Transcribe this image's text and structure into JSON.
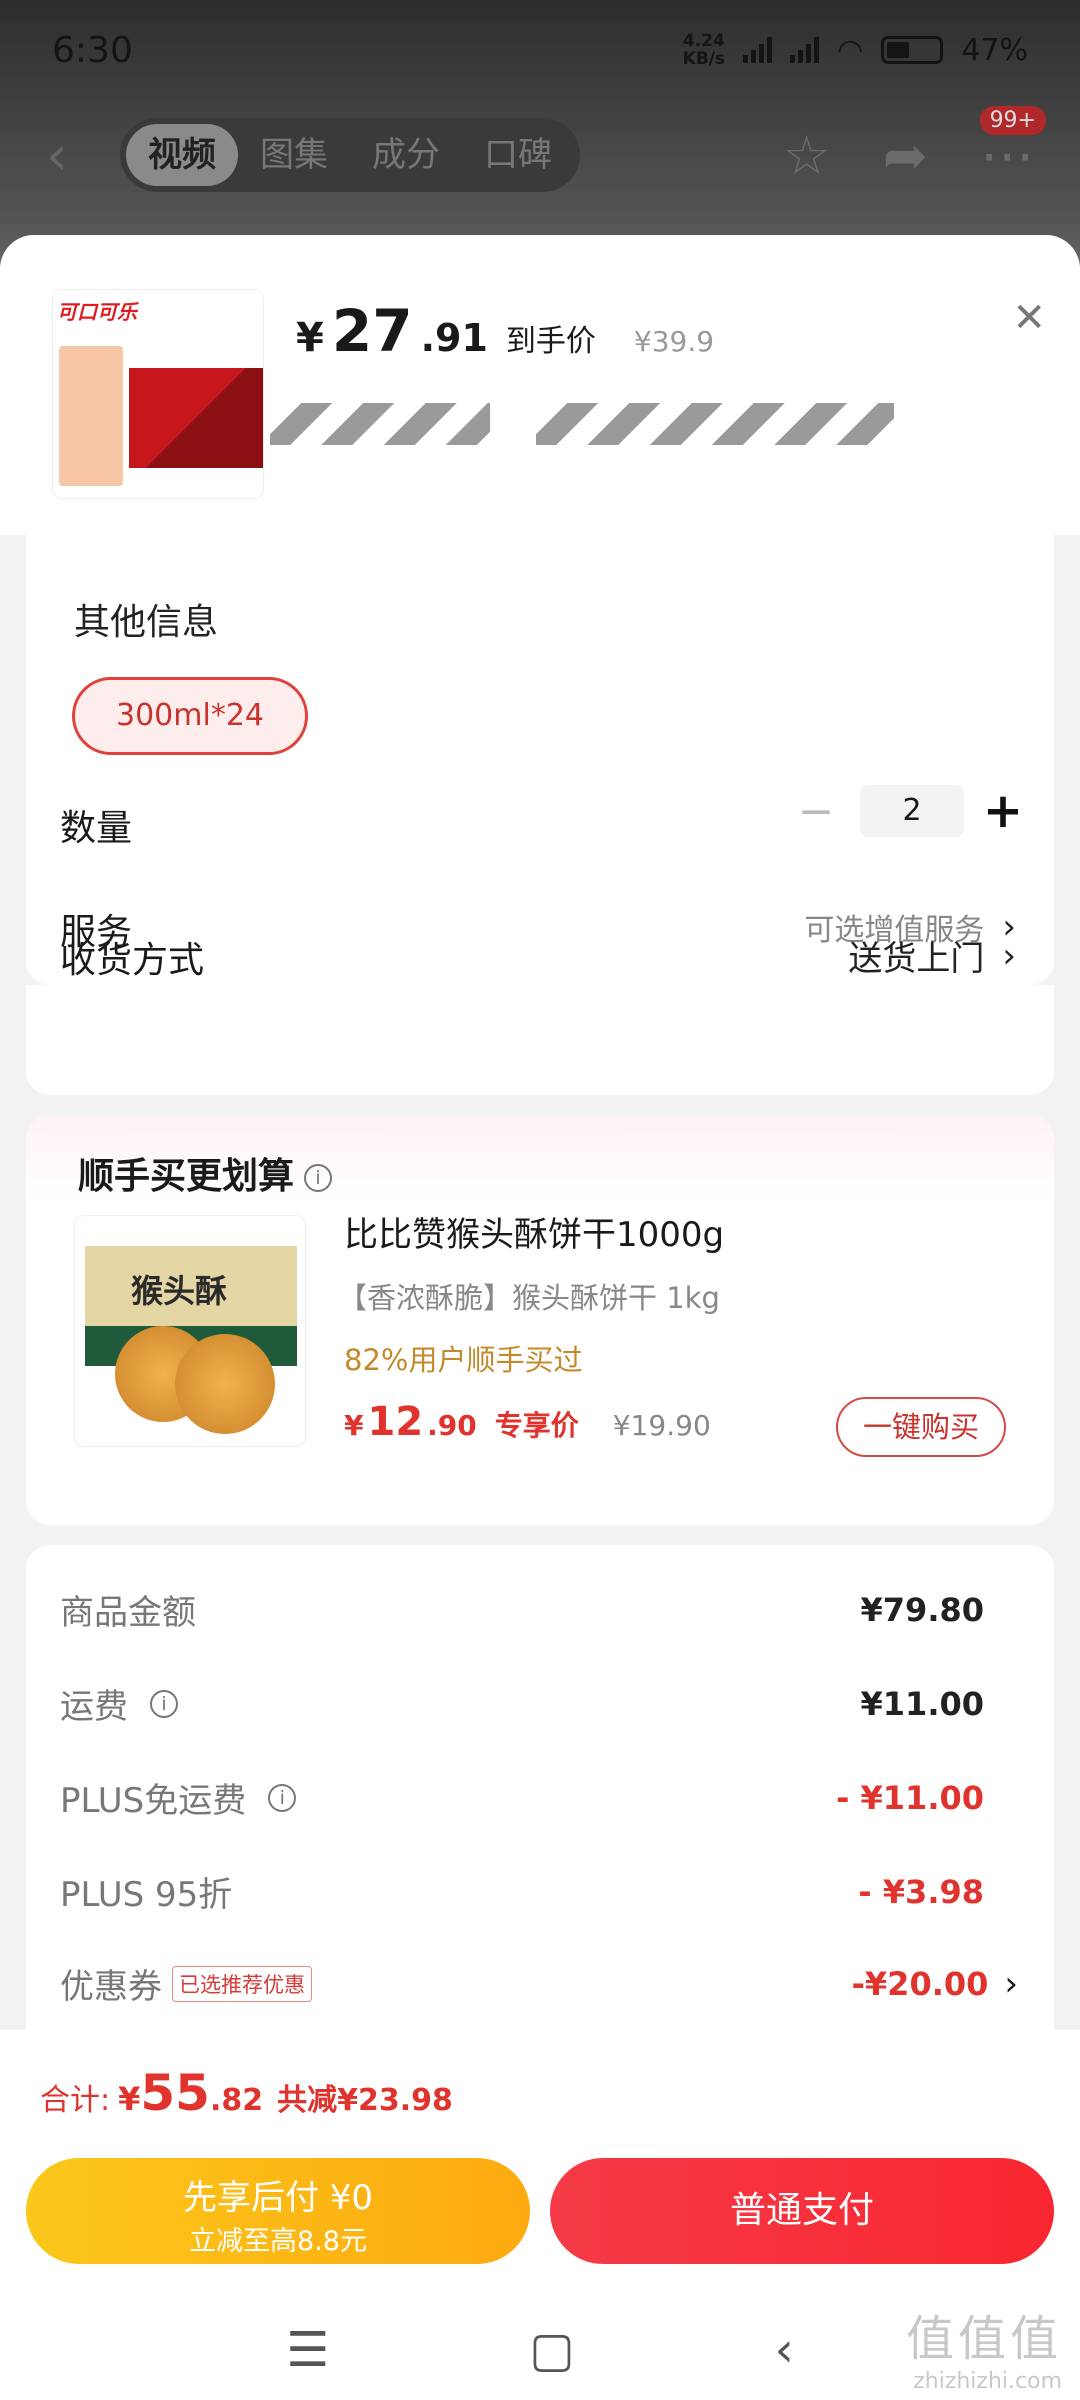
{
  "status_bar": {
    "time": "6:30",
    "net_speed": "4.24",
    "net_unit": "KB/s",
    "battery": "47%"
  },
  "nav": {
    "tabs": [
      "视频",
      "图集",
      "成分",
      "口碑"
    ],
    "active_tab": "视频",
    "badge": "99+"
  },
  "product": {
    "thumb_logo": "可口可乐",
    "price_yen": "¥",
    "price_int": "27",
    "price_dec": ".91",
    "price_label": "到手价",
    "orig_price": "¥39.9"
  },
  "spec": {
    "title": "其他信息",
    "chip": "300ml*24",
    "qty_label": "数量",
    "qty_value": "2",
    "service_label": "服务",
    "service_value": "可选增值服务",
    "delivery_label": "收货方式",
    "delivery_value": "送货上门"
  },
  "recommend": {
    "title": "顺手买更划算",
    "box_text": "猴头酥",
    "name": "比比赞猴头酥饼干1000g",
    "subtitle": "【香浓酥脆】猴头酥饼干 1kg",
    "bought": "82%用户顺手买过",
    "price_yen": "¥",
    "price_int": "12",
    "price_dec": ".90",
    "price_label": "专享价",
    "orig_price": "¥19.90",
    "buy_label": "一键购买"
  },
  "summary": {
    "rows": [
      {
        "label": "商品金额",
        "value": "¥79.80"
      },
      {
        "label": "运费",
        "value": "¥11.00"
      },
      {
        "label": "PLUS免运费",
        "value": "- ¥11.00"
      },
      {
        "label": "PLUS 95折",
        "value": "- ¥3.98"
      },
      {
        "label": "优惠券",
        "value": "-¥20.00",
        "tag": "已选推荐优惠"
      }
    ]
  },
  "bottom": {
    "total_label": "合计:",
    "total_yen": "¥",
    "total_int": "55",
    "total_dec": ".82",
    "saved": "共减¥23.98",
    "later_title": "先享后付 ¥0",
    "later_sub": "立减至高8.8元",
    "pay_label": "普通支付"
  },
  "watermark": {
    "big": "值值值",
    "small": "zhizhizhi.com"
  },
  "colors": {
    "accent_red": "#e0332d",
    "pay_red": "#f53b48",
    "later_yellow": "#fbc71a"
  }
}
